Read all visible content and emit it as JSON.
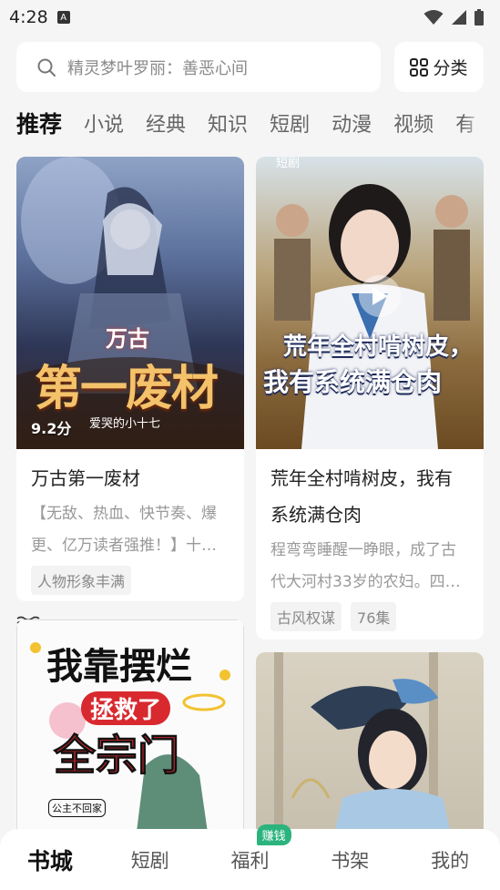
{
  "status_bar": {
    "time": "4:28",
    "notification_letter": "A",
    "icons": [
      "wifi-icon",
      "signal-icon",
      "battery-icon"
    ]
  },
  "search": {
    "placeholder": "精灵梦叶罗丽：善恶心间",
    "category_label": "分类"
  },
  "tabs": [
    {
      "label": "推荐",
      "active": true
    },
    {
      "label": "小说"
    },
    {
      "label": "经典"
    },
    {
      "label": "知识"
    },
    {
      "label": "短剧"
    },
    {
      "label": "动漫"
    },
    {
      "label": "视频"
    },
    {
      "label": "有"
    }
  ],
  "cards": [
    {
      "cover_title_top": "万古",
      "cover_title_main": "第一废材",
      "cover_author": "爱哭的小十七",
      "rating": "9.2分",
      "title": "万古第一废材",
      "desc": "【无敌、热血、快节奏、爆更、亿万读者强推！】十…",
      "tags": [
        "人物形象丰满"
      ]
    },
    {
      "cover_label": "短剧",
      "cover_title_line1": "荒年全村啃树皮，",
      "cover_title_line2": "我有系统满仓肉",
      "title": "荒年全村啃树皮，我有系统满仓肉",
      "desc": "程弯弯睡醒一睁眼，成了古代大河村33岁的农妇。四…",
      "tags": [
        "古风权谋",
        "76集"
      ]
    },
    {
      "cover_title_line1": "我靠摆烂",
      "cover_title_line2": "拯救了",
      "cover_title_line3": "全宗门",
      "cover_small": "公主不回家"
    },
    {}
  ],
  "bottom_nav": [
    {
      "label": "书城",
      "active": true
    },
    {
      "label": "短剧"
    },
    {
      "label": "福利",
      "badge": "赚钱"
    },
    {
      "label": "书架"
    },
    {
      "label": "我的"
    }
  ],
  "colors": {
    "accent_green": "#2bb37e",
    "background": "#f5f5f5"
  }
}
